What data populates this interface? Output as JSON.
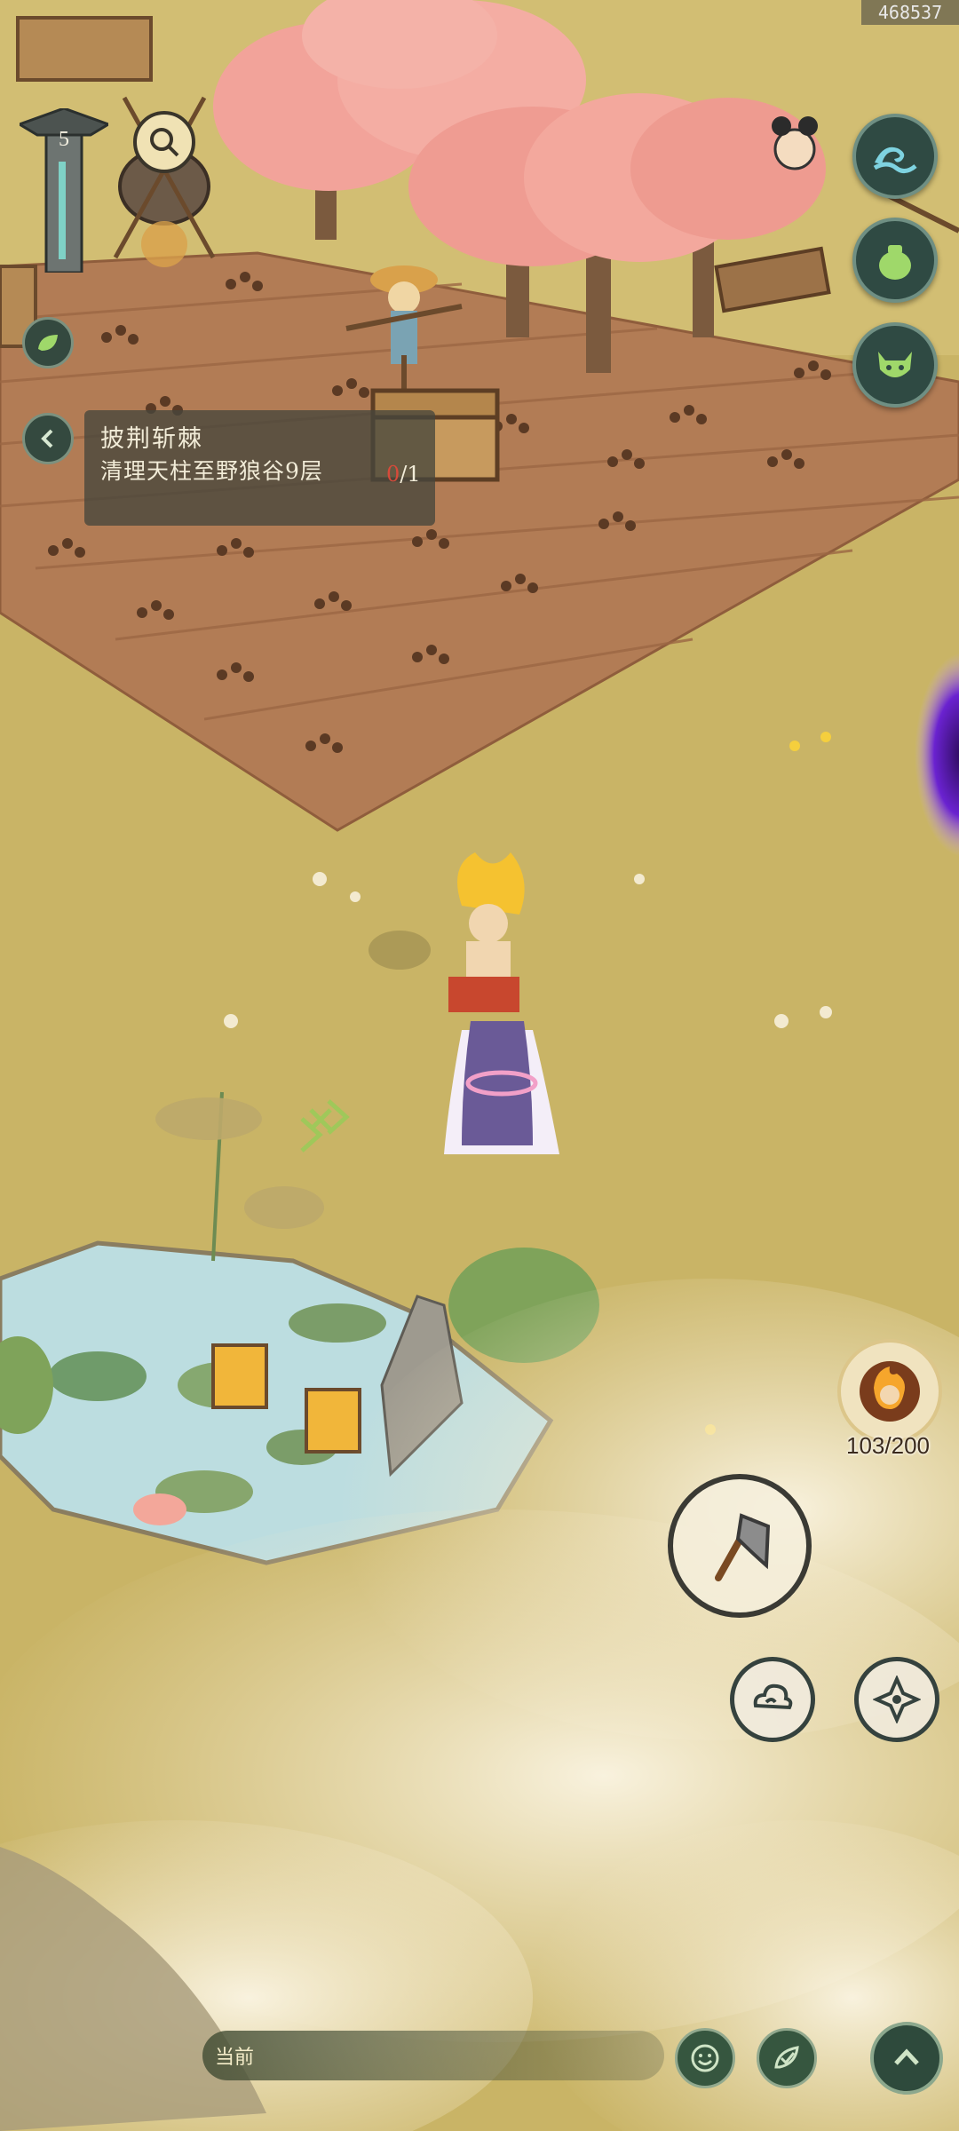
{
  "hud": {
    "uid": "468537",
    "level": "5",
    "quest": {
      "title": "披荆斩棘",
      "description": "清理天柱至野狼谷9层",
      "progress_current": "0",
      "progress_total": "/1"
    },
    "energy": "103/200",
    "chat_label": "当前"
  },
  "icons": {
    "right_menu": [
      "wave-icon",
      "gourd-jar-icon",
      "demon-mask-icon"
    ],
    "action": "axe-icon",
    "skills": [
      "cloud-swirl-icon",
      "shuriken-icon"
    ],
    "bottom": [
      "smile-emote-icon",
      "leaf-check-icon",
      "chevron-up-icon"
    ]
  },
  "colors": {
    "grass": "#c9b466",
    "soil": "#b27c55",
    "blossom": "#f2a39a",
    "water": "#bcdde0",
    "hud_dark": "#2f4a43",
    "portal": "#7a2be0"
  }
}
